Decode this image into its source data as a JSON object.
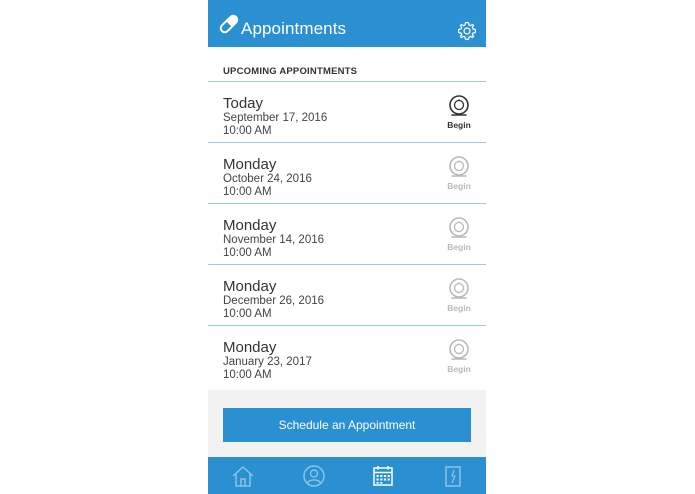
{
  "header": {
    "title": "Appointments",
    "icon": "pill-icon",
    "settings_icon": "gear-icon"
  },
  "section_title": "UPCOMING APPOINTMENTS",
  "appointments": [
    {
      "day": "Today",
      "date": "September 17, 2016",
      "time": "10:00 AM",
      "action": "Begin",
      "active": true
    },
    {
      "day": "Monday",
      "date": "October 24, 2016",
      "time": "10:00 AM",
      "action": "Begin",
      "active": false
    },
    {
      "day": "Monday",
      "date": "November 14, 2016",
      "time": "10:00 AM",
      "action": "Begin",
      "active": false
    },
    {
      "day": "Monday",
      "date": "December 26, 2016",
      "time": "10:00 AM",
      "action": "Begin",
      "active": false
    },
    {
      "day": "Monday",
      "date": "January 23, 2017",
      "time": "10:00 AM",
      "action": "Begin",
      "active": false
    }
  ],
  "schedule_button": "Schedule an Appointment",
  "tabs": [
    {
      "name": "home",
      "icon": "home-icon",
      "selected": false
    },
    {
      "name": "profile",
      "icon": "user-icon",
      "selected": false
    },
    {
      "name": "appointments",
      "icon": "calendar-icon",
      "selected": true
    },
    {
      "name": "records",
      "icon": "document-icon",
      "selected": false
    }
  ],
  "colors": {
    "brand": "#2b90d1",
    "divider": "#9ccbe8",
    "inactive_icon": "#b9b9b9",
    "active_icon": "#333333"
  }
}
